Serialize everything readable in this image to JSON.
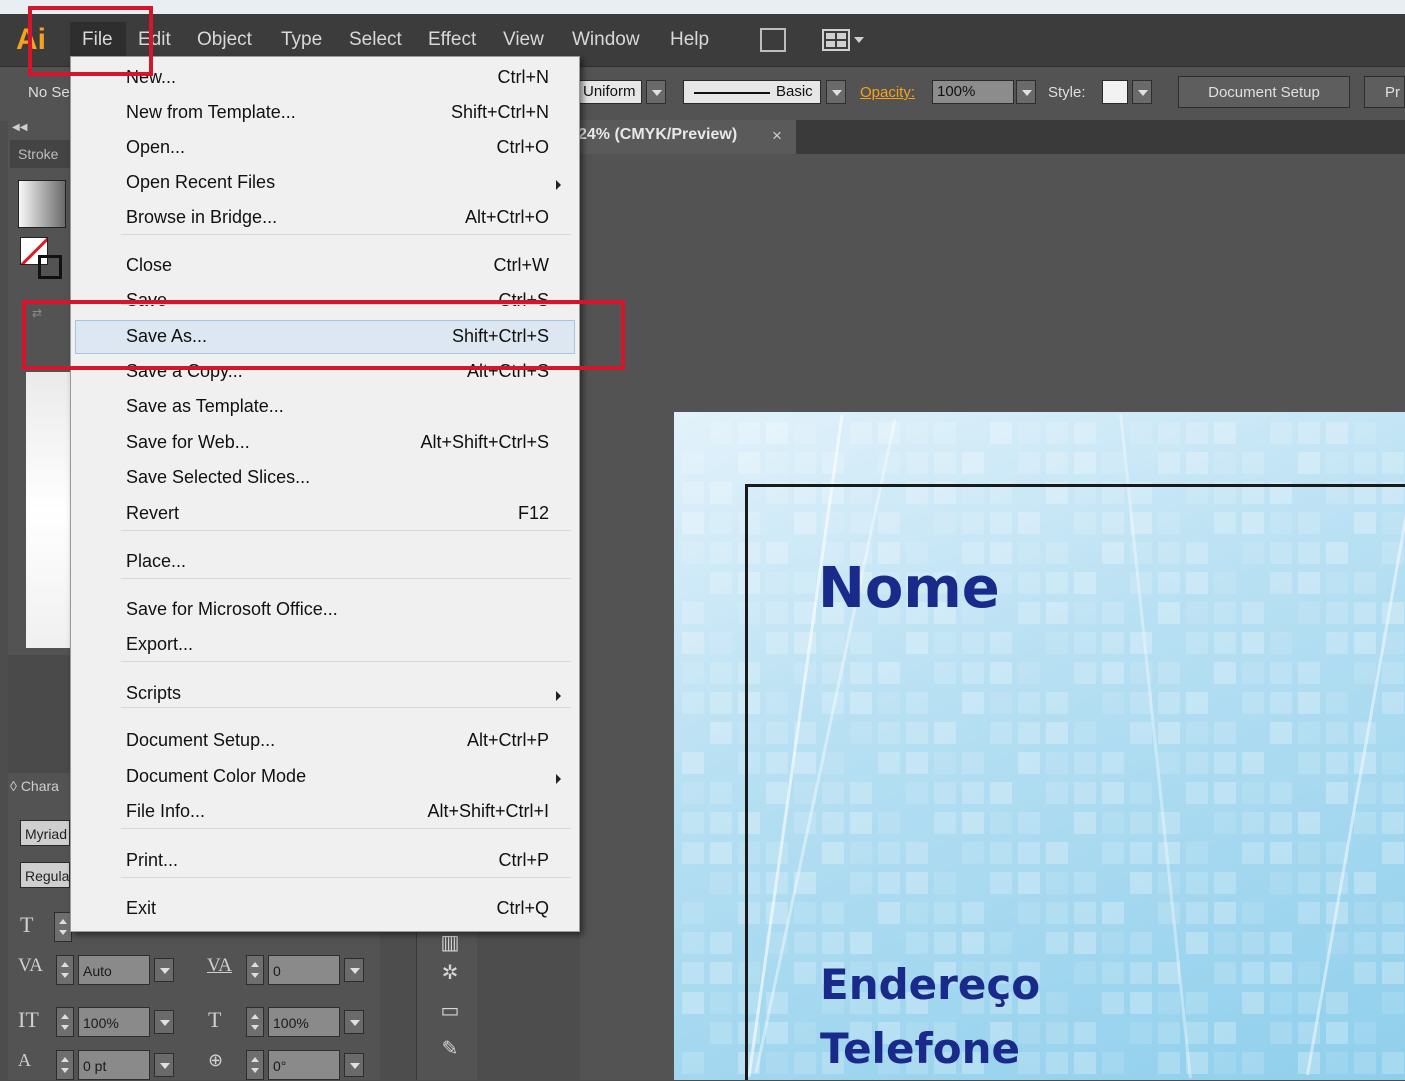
{
  "menubar": {
    "logo": "Ai",
    "items": [
      "File",
      "Edit",
      "Object",
      "Type",
      "Select",
      "Effect",
      "View",
      "Window",
      "Help"
    ]
  },
  "control_bar": {
    "no_selection": "No Se",
    "stroke_profile": "Uniform",
    "brush": "Basic",
    "opacity_label": "Opacity:",
    "opacity_value": "100%",
    "style_label": "Style:",
    "document_setup": "Document Setup",
    "preferences": "Pr"
  },
  "document_tab": {
    "title": "24% (CMYK/Preview)",
    "close": "×"
  },
  "left_panel": {
    "stroke_tab": "Stroke",
    "character_tab": "Chara",
    "font_family": "Myriad",
    "font_style": "Regular"
  },
  "character_controls": {
    "kerning": "Auto",
    "tracking": "0",
    "vertical_scale": "100%",
    "horizontal_scale": "100%",
    "baseline_shift": "0 pt",
    "rotation": "0°"
  },
  "file_menu": {
    "items": [
      {
        "label": "New...",
        "shortcut": "Ctrl+N"
      },
      {
        "label": "New from Template...",
        "shortcut": "Shift+Ctrl+N"
      },
      {
        "label": "Open...",
        "shortcut": "Ctrl+O"
      },
      {
        "label": "Open Recent Files",
        "shortcut": ""
      },
      {
        "label": "Browse in Bridge...",
        "shortcut": "Alt+Ctrl+O"
      },
      {
        "label": "Close",
        "shortcut": "Ctrl+W"
      },
      {
        "label": "Save",
        "shortcut": "Ctrl+S"
      },
      {
        "label": "Save As...",
        "shortcut": "Shift+Ctrl+S"
      },
      {
        "label": "Save a Copy...",
        "shortcut": "Alt+Ctrl+S"
      },
      {
        "label": "Save as Template...",
        "shortcut": ""
      },
      {
        "label": "Save for Web...",
        "shortcut": "Alt+Shift+Ctrl+S"
      },
      {
        "label": "Save Selected Slices...",
        "shortcut": ""
      },
      {
        "label": "Revert",
        "shortcut": "F12"
      },
      {
        "label": "Place...",
        "shortcut": ""
      },
      {
        "label": "Save for Microsoft Office...",
        "shortcut": ""
      },
      {
        "label": "Export...",
        "shortcut": ""
      },
      {
        "label": "Scripts",
        "shortcut": ""
      },
      {
        "label": "Document Setup...",
        "shortcut": "Alt+Ctrl+P"
      },
      {
        "label": "Document Color Mode",
        "shortcut": ""
      },
      {
        "label": "File Info...",
        "shortcut": "Alt+Shift+Ctrl+I"
      },
      {
        "label": "Print...",
        "shortcut": "Ctrl+P"
      },
      {
        "label": "Exit",
        "shortcut": "Ctrl+Q"
      }
    ],
    "highlighted": "Save As..."
  },
  "artboard": {
    "name": "Nome",
    "address": "Endereço",
    "phone": "Telefone"
  },
  "colors": {
    "annotation_red": "#d4152b",
    "card_text_blue": "#1a2a8a",
    "opacity_label_orange": "#f7a21b"
  }
}
